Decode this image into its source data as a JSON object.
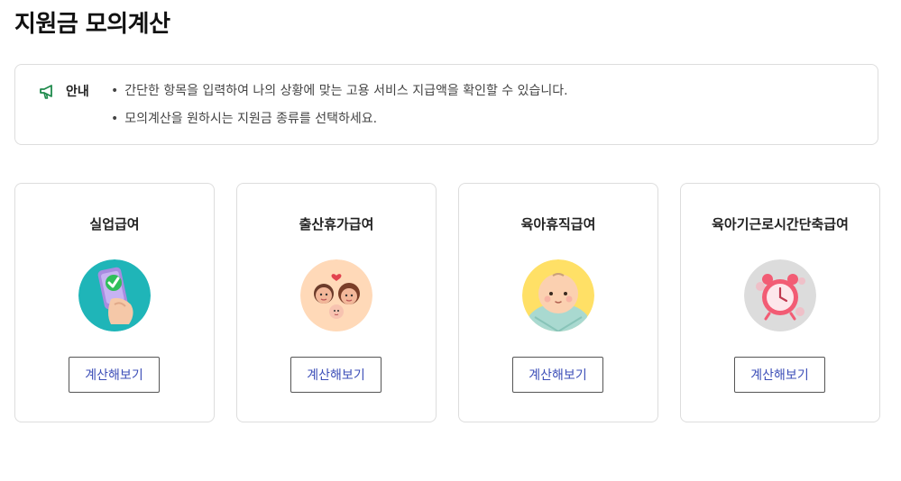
{
  "page": {
    "title": "지원금 모의계산"
  },
  "notice": {
    "icon": "megaphone-icon",
    "icon_color": "#1f8a4c",
    "label": "안내",
    "items": [
      "간단한 항목을 입력하여 나의 상황에 맞는 고용 서비스 지급액을 확인할 수 있습니다.",
      "모의계산을 원하시는 지원금 종류를 선택하세요."
    ]
  },
  "cards": [
    {
      "title": "실업급여",
      "icon": "phone-check-hand-icon",
      "bg_color": "#1fb5b8",
      "button_label": "계산해보기"
    },
    {
      "title": "출산휴가급여",
      "icon": "parents-baby-icon",
      "bg_color": "#ffd9b8",
      "button_label": "계산해보기"
    },
    {
      "title": "육아휴직급여",
      "icon": "baby-face-icon",
      "bg_color": "#ffe066",
      "button_label": "계산해보기"
    },
    {
      "title": "육아기근로시간단축급여",
      "icon": "alarm-clock-icon",
      "bg_color": "#dcdcdc",
      "button_label": "계산해보기"
    }
  ],
  "colors": {
    "button_text": "#3d4fb8",
    "border": "#dddddd"
  }
}
